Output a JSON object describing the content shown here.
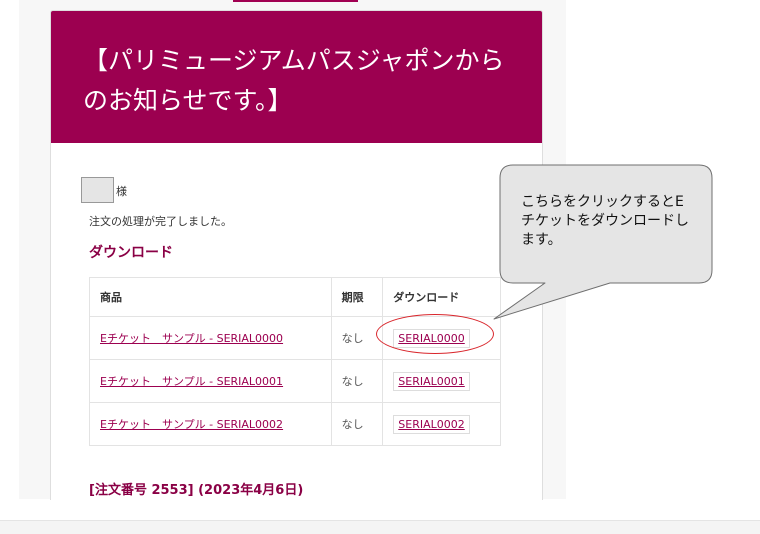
{
  "email": {
    "header_title": "【パリミュージアムパスジャポンからのお知らせです。】",
    "honorific": "様",
    "order_complete": "注文の処理が完了しました。",
    "download_heading": "ダウンロード",
    "table": {
      "headers": [
        "商品",
        "期限",
        "ダウンロード"
      ],
      "rows": [
        {
          "product": "Eチケット　サンプル - SERIAL0000",
          "expiry": "なし",
          "download": "SERIAL0000"
        },
        {
          "product": "Eチケット　サンプル - SERIAL0001",
          "expiry": "なし",
          "download": "SERIAL0001"
        },
        {
          "product": "Eチケット　サンプル - SERIAL0002",
          "expiry": "なし",
          "download": "SERIAL0002"
        }
      ]
    },
    "order_heading": "[注文番号 2553] (2023年4月6日)"
  },
  "annotation": {
    "callout_text": "こちらをクリックするとEチケットをダウンロードします。"
  },
  "colors": {
    "brand": "#9c0050",
    "heading": "#8a0045",
    "annotation_red": "#d9262c",
    "callout_fill": "#e5e5e5"
  }
}
